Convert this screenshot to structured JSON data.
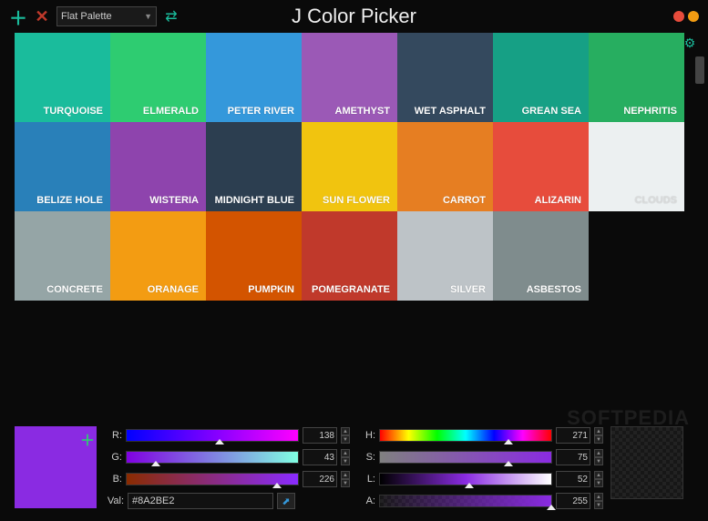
{
  "header": {
    "palette_name": "Flat Palette",
    "app_title": "J Color Picker"
  },
  "palette": [
    {
      "name": "TURQUOISE",
      "color": "#1abc9c"
    },
    {
      "name": "ELMERALD",
      "color": "#2ecc71"
    },
    {
      "name": "PETER RIVER",
      "color": "#3498db"
    },
    {
      "name": "AMETHYST",
      "color": "#9b59b6"
    },
    {
      "name": "WET ASPHALT",
      "color": "#34495e"
    },
    {
      "name": "GREAN SEA",
      "color": "#16a085"
    },
    {
      "name": "NEPHRITIS",
      "color": "#27ae60"
    },
    {
      "name": "BELIZE HOLE",
      "color": "#2980b9"
    },
    {
      "name": "WISTERIA",
      "color": "#8e44ad"
    },
    {
      "name": "MIDNIGHT BLUE",
      "color": "#2c3e50"
    },
    {
      "name": "SUN FLOWER",
      "color": "#f1c40f"
    },
    {
      "name": "CARROT",
      "color": "#e67e22"
    },
    {
      "name": "ALIZARIN",
      "color": "#e74c3c"
    },
    {
      "name": "CLOUDS",
      "color": "#ecf0f1"
    },
    {
      "name": "CONCRETE",
      "color": "#95a5a6"
    },
    {
      "name": "ORANAGE",
      "color": "#f39c12"
    },
    {
      "name": "PUMPKIN",
      "color": "#d35400"
    },
    {
      "name": "POMEGRANATE",
      "color": "#c0392b"
    },
    {
      "name": "SILVER",
      "color": "#bdc3c7"
    },
    {
      "name": "ASBESTOS",
      "color": "#7f8c8d"
    }
  ],
  "current": {
    "preview_color": "#8A2BE2",
    "val_label": "Val:",
    "val": "#8A2BE2",
    "rgb": {
      "r_label": "R:",
      "r": "138",
      "g_label": "G:",
      "g": "43",
      "b_label": "B:",
      "b": "226"
    },
    "hsla": {
      "h_label": "H:",
      "h": "271",
      "s_label": "S:",
      "s": "75",
      "l_label": "L:",
      "l": "52",
      "a_label": "A:",
      "a": "255"
    }
  },
  "watermark": "SOFTPEDIA"
}
